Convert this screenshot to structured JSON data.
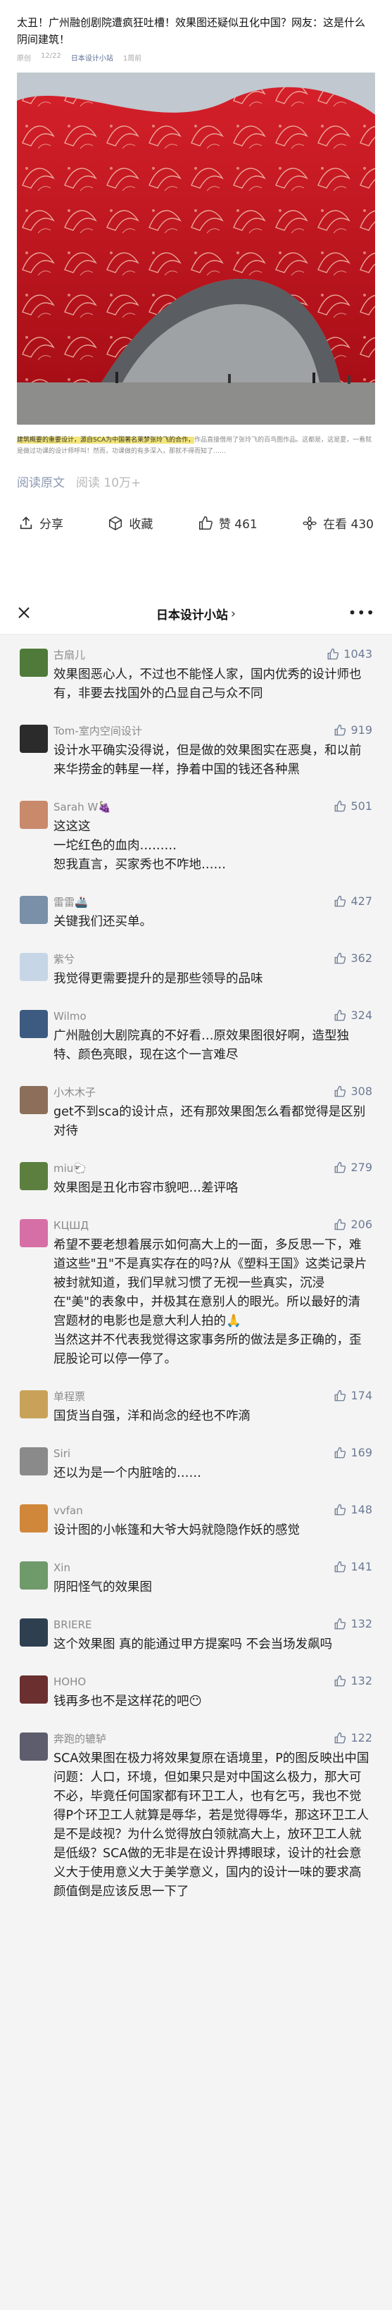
{
  "article": {
    "title": "太丑！广州融创剧院遭疯狂吐槽！效果图还疑似丑化中国？网友：这是什么阴间建筑！",
    "meta": [
      "原创",
      "12/22",
      "日本设计小站",
      "1周前"
    ],
    "caption_highlight": "建筑概要的重要设计，源自SCA为中国著名莱梦张玲飞的合作，",
    "caption_rest": "作品直接借用了张玲飞的百鸟图作品。这都是，这是夏，一看就是做过功课的设计师呼叫！然而，功课做的有多深入，那就不得而知了……",
    "read_label": "阅读原文",
    "read_count": "阅读 10万+"
  },
  "actions": {
    "share": "分享",
    "fav": "收藏",
    "like": "赞 461",
    "watch": "在看 430"
  },
  "panel": {
    "title": "日本设计小站",
    "chevron": "›",
    "more": "•••"
  },
  "comments": [
    {
      "nick": "古扇儿",
      "likes": "1043",
      "text": "效果图恶心人，不过也不能怪人家，国内优秀的设计师也有，非要去找国外的凸显自己与众不同"
    },
    {
      "nick": "Tom-室内空间设计",
      "likes": "919",
      "text": "设计水平确实没得说，但是做的效果图实在恶臭，和以前来华捞金的韩星一样，挣着中国的钱还各种黑"
    },
    {
      "nick": "Sarah W🍇",
      "likes": "501",
      "text": "这这这\n一坨红色的血肉………\n恕我直言，买家秀也不咋地……"
    },
    {
      "nick": "雷雷🚢",
      "likes": "427",
      "text": "关键我们还买单。"
    },
    {
      "nick": "紫兮",
      "likes": "362",
      "text": "我觉得更需要提升的是那些领导的品味"
    },
    {
      "nick": "Wilmo",
      "likes": "324",
      "text": "广州融创大剧院真的不好看…原效果图很好啊，造型独特、颜色亮眼，现在这个一言难尽"
    },
    {
      "nick": "小木木子",
      "likes": "308",
      "text": "get不到sca的设计点，还有那效果图怎么看都觉得是区别对待"
    },
    {
      "nick": "miu🐑",
      "likes": "279",
      "text": "效果图是丑化市容市貌吧…差评咯"
    },
    {
      "nick": "КЦШД",
      "likes": "206",
      "text": "希望不要老想着展示如何高大上的一面，多反思一下，难道这些\"丑\"不是真实存在的吗?从《塑料王国》这类记录片被封就知道，我们早就习惯了无视一些真实，沉浸在\"美\"的表象中，并极其在意别人的眼光。所以最好的清宫题材的电影也是意大利人拍的🙏\n当然这并不代表我觉得这家事务所的做法是多正确的，歪屁股论可以停一停了。"
    },
    {
      "nick": "单程票",
      "likes": "174",
      "text": "国货当自强，洋和尚念的经也不咋滴"
    },
    {
      "nick": "Siri",
      "likes": "169",
      "text": "还以为是一个内脏啥的……"
    },
    {
      "nick": "vvfan",
      "likes": "148",
      "text": "设计图的小帐篷和大爷大妈就隐隐作妖的感觉"
    },
    {
      "nick": "Xin",
      "likes": "141",
      "text": "阴阳怪气的效果图"
    },
    {
      "nick": "BRIERE",
      "likes": "132",
      "text": "这个效果图 真的能通过甲方提案吗 不会当场发飙吗"
    },
    {
      "nick": "HOHO",
      "likes": "132",
      "text": "钱再多也不是这样花的吧😶"
    },
    {
      "nick": "奔跑的辘轳",
      "likes": "122",
      "text": "SCA效果图在极力将效果复原在语境里，P的图反映出中国问题：人口，环境，但如果只是对中国这么极力，那大可不必，毕竟任何国家都有环卫工人，也有乞丐，我也不觉得P个环卫工人就算是辱华，若是觉得辱华，那这环卫工人是不是歧视？为什么觉得放白领就高大上，放环卫工人就是低级？SCA做的无非是在设计界搏眼球，设计的社会意义大于使用意义大于美学意义，国内的设计一味的要求高颜值倒是应该反思一下了"
    }
  ],
  "colors": {
    "accent_link": "#6c7a94",
    "panel_bg": "#f4f4f4",
    "building_red": "#c8161d"
  }
}
